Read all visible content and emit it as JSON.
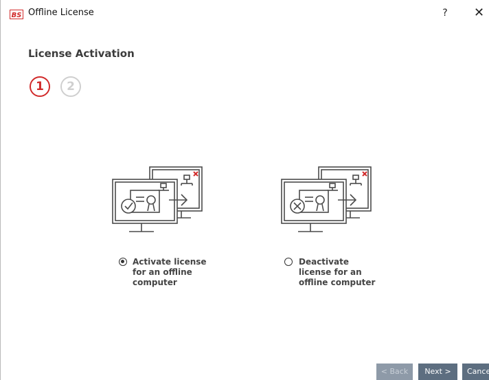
{
  "window": {
    "icon_label": "BS",
    "title": "Offline License",
    "help_label": "?",
    "close_label": "✕"
  },
  "page": {
    "title": "License Activation"
  },
  "steps": [
    {
      "number": "1",
      "state": "active"
    },
    {
      "number": "2",
      "state": "inactive"
    }
  ],
  "options": [
    {
      "label_lines": [
        "Activate license",
        "for an offline",
        "computer"
      ],
      "selected": true,
      "icon": "activate-license-illustration"
    },
    {
      "label_lines": [
        "Deactivate",
        "license for an",
        "offline computer"
      ],
      "selected": false,
      "icon": "deactivate-license-illustration"
    }
  ],
  "buttons": {
    "back": "< Back",
    "next": "Next >",
    "cancel": "Cancel"
  },
  "colors": {
    "accent_red": "#d12a2a",
    "button_active": "#5d6e80",
    "button_disabled": "#8e9aa8"
  }
}
